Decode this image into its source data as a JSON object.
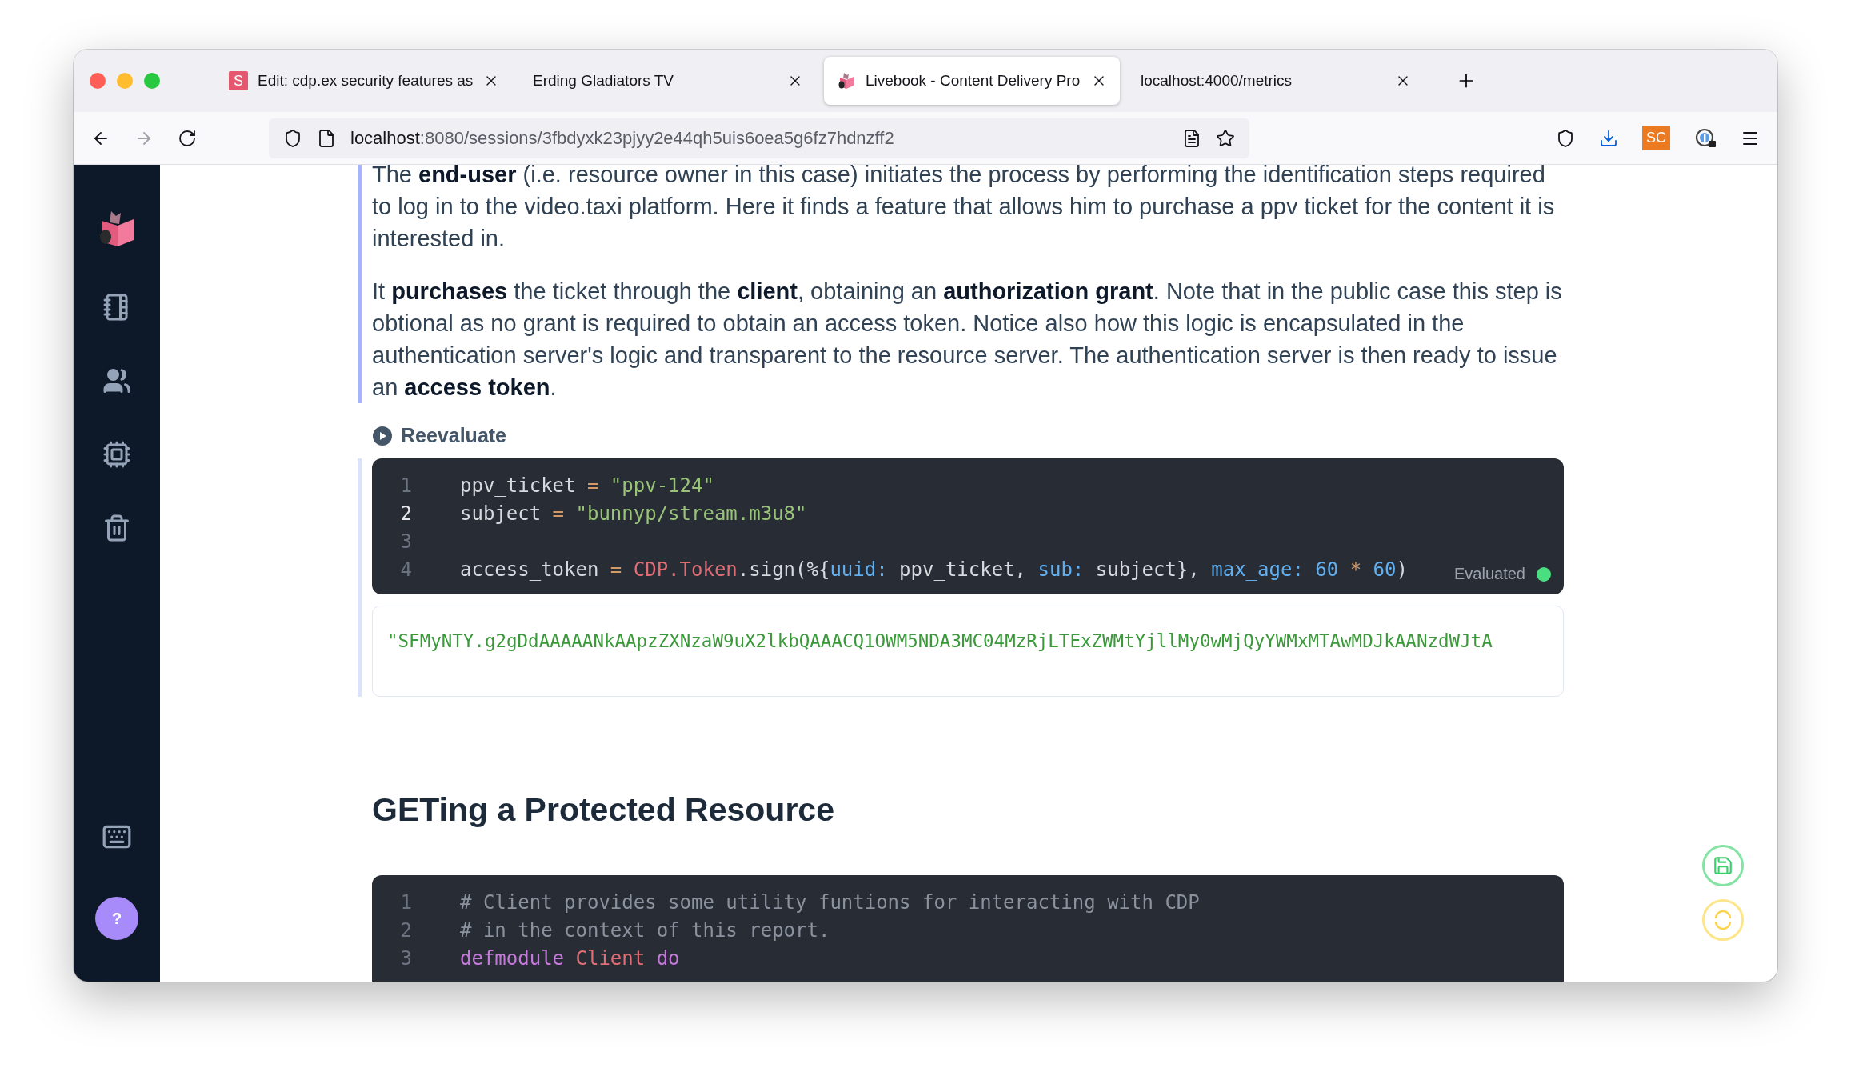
{
  "browser": {
    "tabs": [
      {
        "title": "Edit: cdp.ex security features as",
        "favicon": {
          "kind": "letter",
          "text": "S"
        },
        "selected": false
      },
      {
        "title": "Erding Gladiators TV",
        "selected": false
      },
      {
        "title": "Livebook - Content Delivery Pro",
        "favicon": {
          "kind": "livebook"
        },
        "selected": true
      },
      {
        "title": "localhost:4000/metrics",
        "selected": false
      }
    ],
    "url": {
      "host": "localhost",
      "rest": ":8080/sessions/3fbdyxk23pjyy2e44qh5uis6oea5g6fz7hdnzff2"
    },
    "extension": "SC"
  },
  "notebook": {
    "paragraphs": [
      "The **end-user** (i.e. resource owner in this case) initiates the process by performing the identification steps required to log in to the video.taxi platform. Here it finds a feature that allows him to purchase a ppv ticket for the content it is interested in.",
      "It **purchases** the ticket through the **client**, obtaining an **authorization grant**. Note that in the public case this step is obtional as no grant is required to obtain an access token. Notice also how this logic is encapsulated in the authentication server's logic and transparent to the resource server. The authentication server is then ready to issue an **access token**."
    ],
    "cell": {
      "action": "Reevaluate",
      "status": "Evaluated",
      "lines": [
        {
          "number": "1",
          "active": false,
          "tokens": [
            {
              "kind": "plain",
              "text": "ppv_ticket "
            },
            {
              "kind": "op",
              "text": "= "
            },
            {
              "kind": "string",
              "text": "\"ppv-124\""
            }
          ]
        },
        {
          "number": "2",
          "active": true,
          "tokens": [
            {
              "kind": "plain",
              "text": "subject "
            },
            {
              "kind": "op",
              "text": "= "
            },
            {
              "kind": "string",
              "text": "\"bunnyp/stream.m3u8\""
            }
          ]
        },
        {
          "number": "3",
          "active": false
        },
        {
          "number": "4",
          "active": false,
          "tokens": [
            {
              "kind": "plain",
              "text": "access_token "
            },
            {
              "kind": "op",
              "text": "= "
            },
            {
              "kind": "module",
              "text": "CDP.Token"
            },
            {
              "kind": "plain",
              "text": ".sign(%{"
            },
            {
              "kind": "key",
              "text": "uuid:"
            },
            {
              "kind": "plain",
              "text": " ppv_ticket, "
            },
            {
              "kind": "key",
              "text": "sub:"
            },
            {
              "kind": "plain",
              "text": " subject}, "
            },
            {
              "kind": "key",
              "text": "max_age:"
            },
            {
              "kind": "number",
              "text": " 60"
            },
            {
              "kind": "op",
              "text": " * "
            },
            {
              "kind": "number",
              "text": "60"
            },
            {
              "kind": "plain",
              "text": ")"
            }
          ]
        }
      ],
      "output": "\"SFMyNTY.g2gDdAAAAANkAApzZXNzaW9uX2lkbQAAACQ1OWM5NDA3MC04MzRjLTExZWMtYjllMy0wMjQyYWMxMTAwMDJkAANzdWJtA"
    },
    "heading": "GETing a Protected Resource",
    "cell2": {
      "lines": [
        {
          "number": "1",
          "active": false,
          "tokens": [
            {
              "kind": "comment",
              "text": "# Client provides some utility funtions for interacting with CDP"
            }
          ]
        },
        {
          "number": "2",
          "active": false,
          "tokens": [
            {
              "kind": "comment",
              "text": "# in the context of this report."
            }
          ]
        },
        {
          "number": "3",
          "active": false,
          "tokens": [
            {
              "kind": "keyword",
              "text": "defmodule "
            },
            {
              "kind": "module",
              "text": "Client "
            },
            {
              "kind": "keyword",
              "text": "do"
            }
          ]
        }
      ]
    }
  },
  "help": "?"
}
